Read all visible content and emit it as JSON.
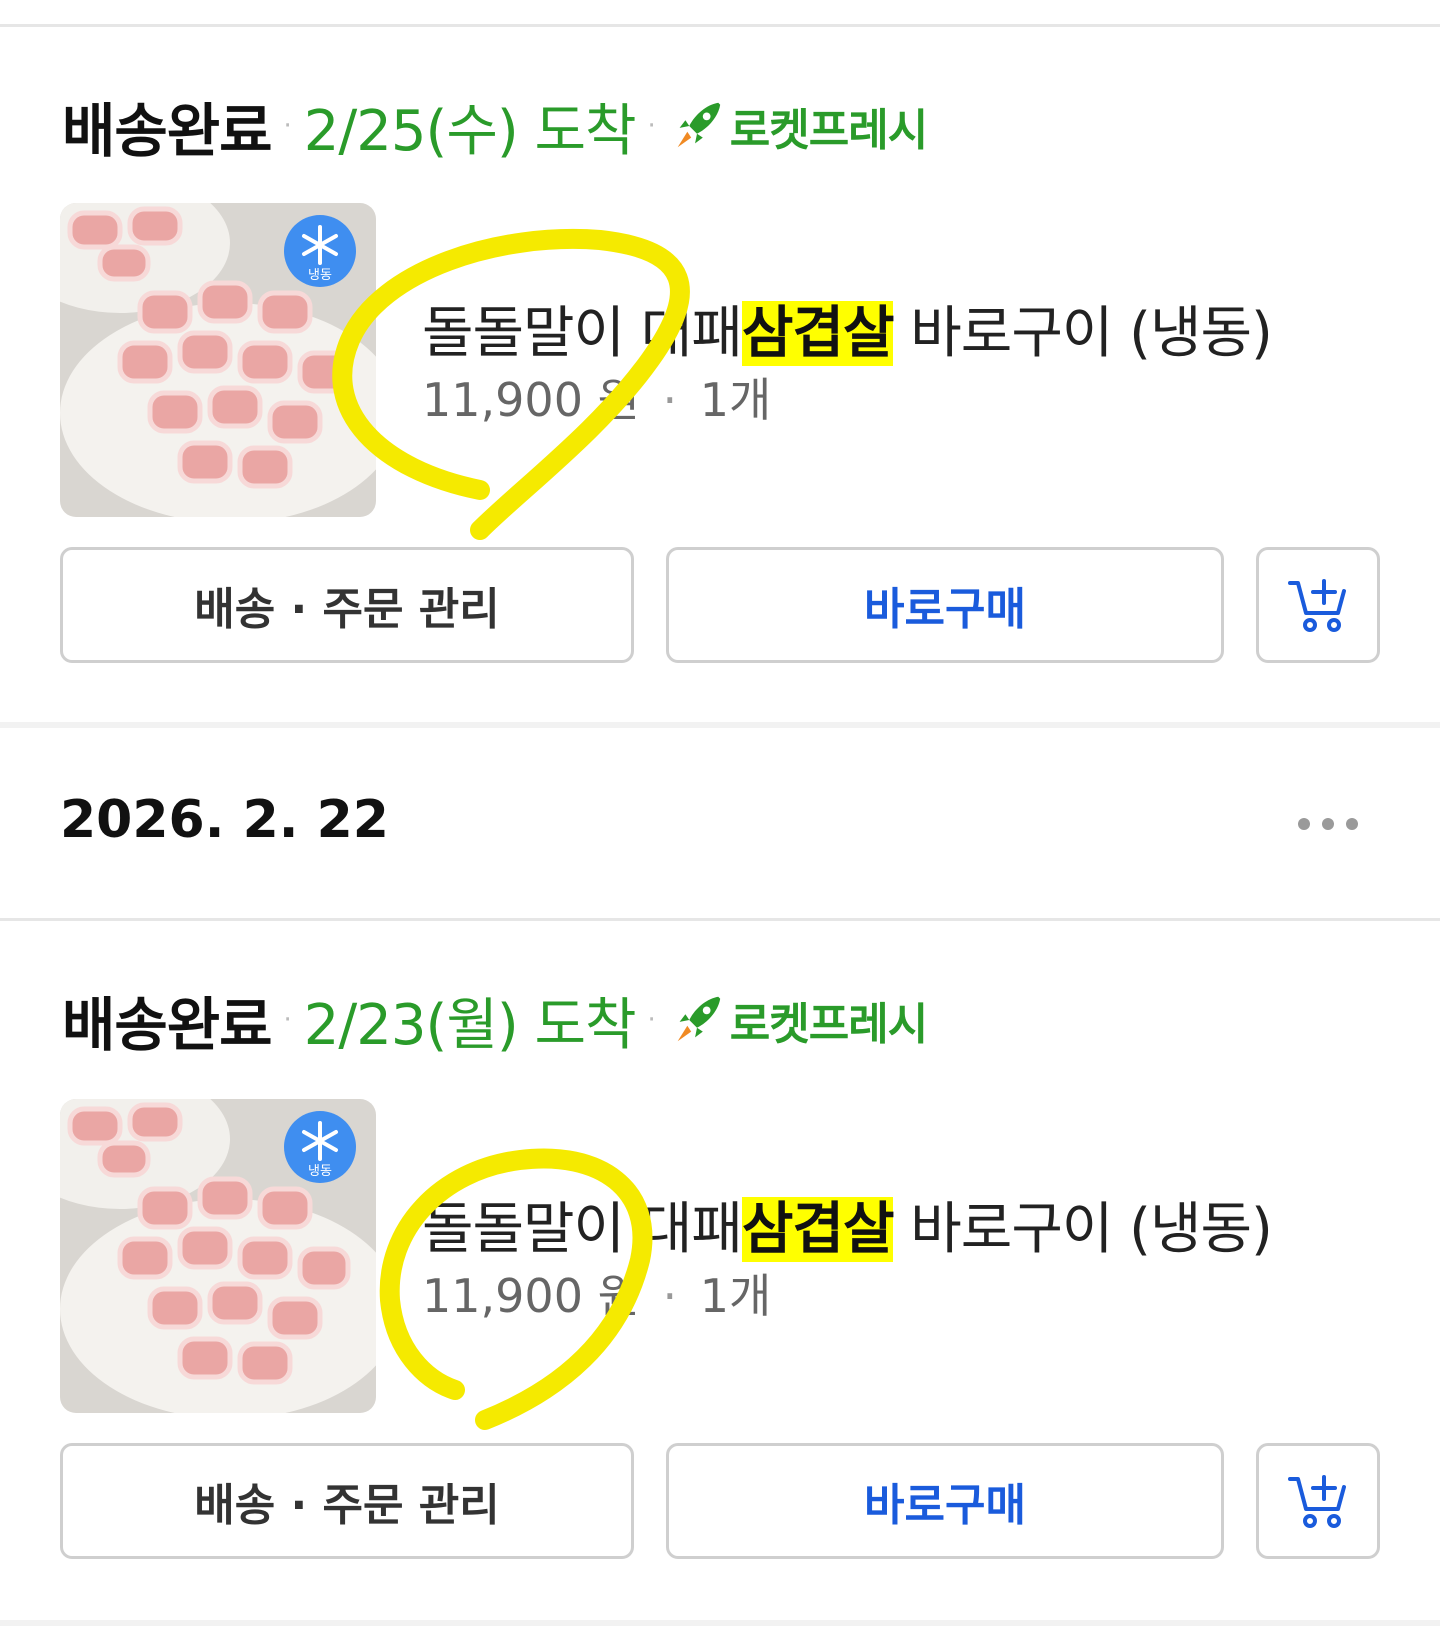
{
  "orders": [
    {
      "status": "배송완료",
      "arrival": "2/25(수) 도착",
      "rocket_label": "로켓프레시",
      "product": {
        "name_prefix": "돌돌말이 대패",
        "name_highlight": "삼겹살",
        "name_suffix": " 바로구이 (냉동)",
        "price": "11,900 원",
        "qty": "1개"
      },
      "frozen_badge": "냉동",
      "buttons": {
        "manage": "배송 · 주문 관리",
        "buy": "바로구매"
      }
    },
    {
      "status": "배송완료",
      "arrival": "2/23(월) 도착",
      "rocket_label": "로켓프레시",
      "product": {
        "name_prefix": "돌돌말이 대패",
        "name_highlight": "삼겹살",
        "name_suffix": " 바로구이 (냉동)",
        "price": "11,900 원",
        "qty": "1개"
      },
      "frozen_badge": "냉동",
      "buttons": {
        "manage": "배송 · 주문 관리",
        "buy": "바로구매"
      }
    }
  ],
  "order_group": {
    "date": "2026. 2. 22"
  },
  "separator": "·",
  "colors": {
    "arrival_green": "#2a9b2a",
    "buy_blue": "#1a5bdc",
    "highlight_yellow": "#ffff00",
    "annotation_yellow": "#f5ea00"
  },
  "icons": [
    "rocket-icon",
    "snowflake-icon",
    "cart-add-icon",
    "more-dots-icon"
  ]
}
